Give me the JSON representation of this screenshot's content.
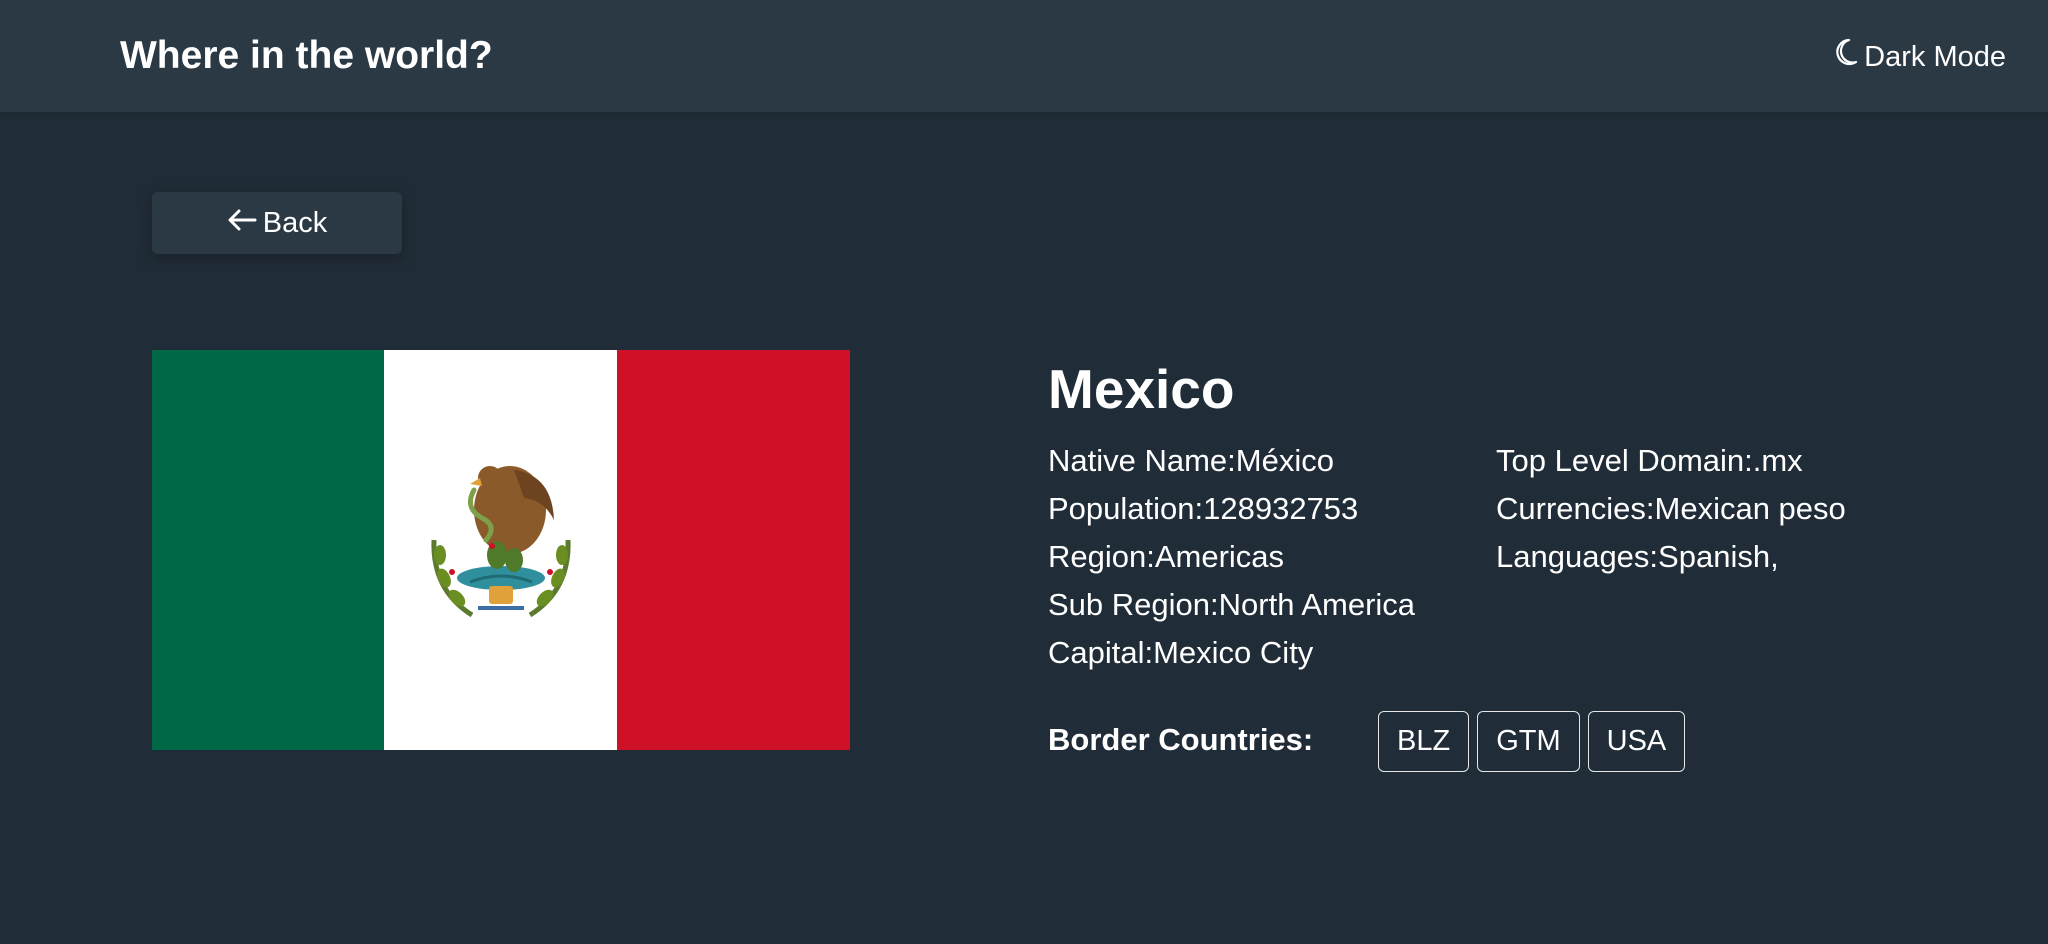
{
  "header": {
    "title": "Where in the world?",
    "theme_toggle_label": "Dark Mode",
    "theme_icon": "moon-icon"
  },
  "back_button": {
    "label": "Back",
    "icon": "arrow-left-icon"
  },
  "flag": {
    "description_icon": "mexico-flag",
    "colors": {
      "green": "#006847",
      "white": "#ffffff",
      "red": "#ce1126"
    }
  },
  "country": {
    "name": "Mexico",
    "details_left": [
      {
        "label": "Native Name:",
        "value": "México"
      },
      {
        "label": "Population:",
        "value": "128932753"
      },
      {
        "label": "Region:",
        "value": "Americas"
      },
      {
        "label": "Sub Region:",
        "value": "North America"
      },
      {
        "label": "Capital:",
        "value": "Mexico City"
      }
    ],
    "details_right": [
      {
        "label": "Top Level Domain:",
        "value": ".mx"
      },
      {
        "label": "Currencies:",
        "value": "Mexican peso"
      },
      {
        "label": "Languages:",
        "value": "Spanish,"
      }
    ],
    "border_countries_label": "Border Countries:",
    "border_countries": [
      "BLZ",
      "GTM",
      "USA"
    ]
  },
  "colors": {
    "background": "#202c37",
    "elements": "#2b3945",
    "text": "#ffffff"
  }
}
